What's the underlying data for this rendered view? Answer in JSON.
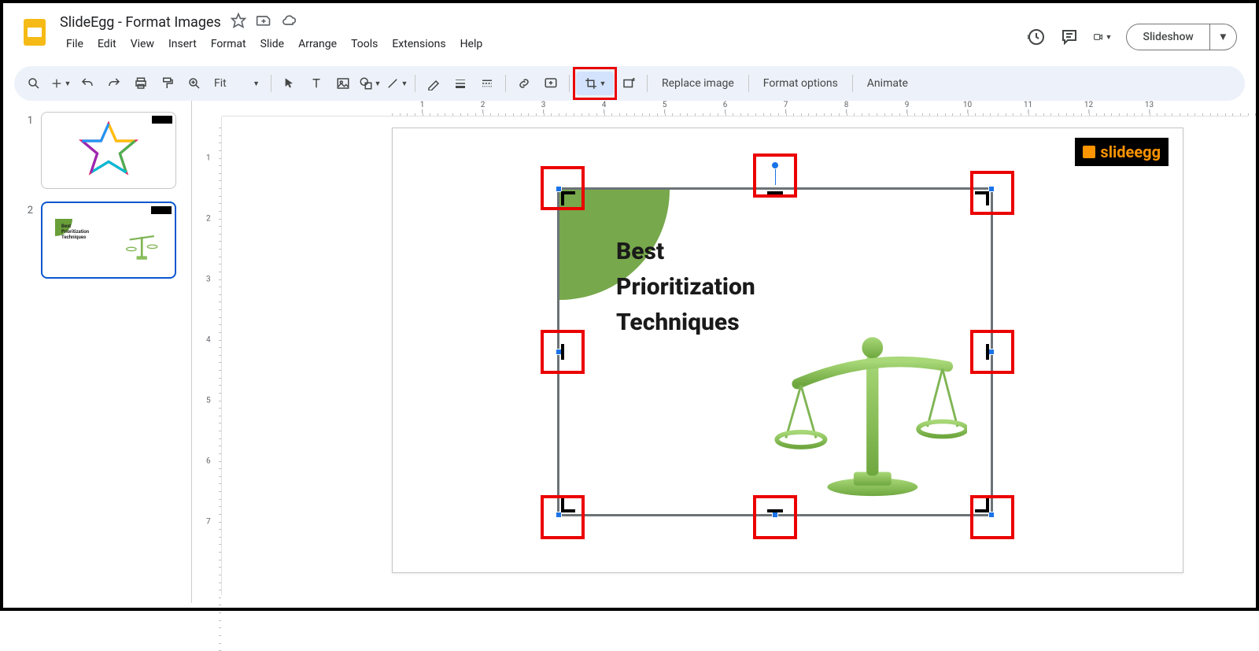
{
  "doc": {
    "title": "SlideEgg - Format Images"
  },
  "menus": [
    "File",
    "Edit",
    "View",
    "Insert",
    "Format",
    "Slide",
    "Arrange",
    "Tools",
    "Extensions",
    "Help"
  ],
  "zoom": "Fit",
  "toolbar_text": {
    "replace_image": "Replace image",
    "format_options": "Format options",
    "animate": "Animate"
  },
  "header_buttons": {
    "slideshow": "Slideshow"
  },
  "slides": [
    {
      "num": "1"
    },
    {
      "num": "2"
    }
  ],
  "slide_content": {
    "line1": "Best",
    "line2": "Prioritization",
    "line3": "Techniques",
    "logo_text": "slideegg"
  },
  "ruler_h": [
    "1",
    "2",
    "3",
    "4",
    "5",
    "6",
    "7",
    "8",
    "9",
    "10",
    "11",
    "12",
    "13"
  ],
  "ruler_v": [
    "1",
    "2",
    "3",
    "4",
    "5",
    "6",
    "7"
  ]
}
